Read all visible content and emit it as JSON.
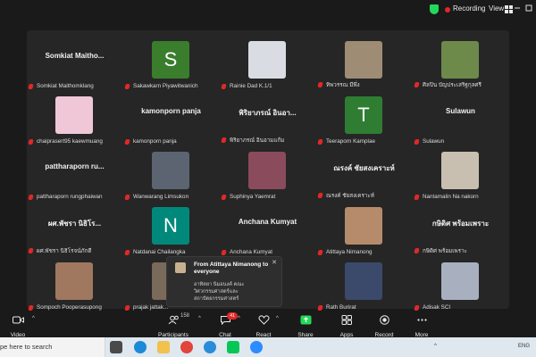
{
  "topbar": {
    "recording_label": "Recording",
    "view_label": "View"
  },
  "participants": [
    {
      "display": "Somkiat  Maitho...",
      "label": "Somkiat Maithomklang",
      "kind": "name"
    },
    {
      "display": "S",
      "label": "Sakawkarn Piyawitwanich",
      "kind": "avatar",
      "color": "#3a7d2c"
    },
    {
      "display": "",
      "label": "Rainie Dad K.1/1",
      "kind": "photo",
      "color": "#d9dde3"
    },
    {
      "display": "",
      "label": "ทิพวรรณ มีพึ่ง",
      "kind": "photo",
      "color": "#9e8c74"
    },
    {
      "display": "",
      "label": "ศิลปิน บัญประเสริฐกุลศรี",
      "kind": "photo",
      "color": "#6d8a4a"
    },
    {
      "display": "",
      "label": "chaiprasert95 kaewmuang",
      "kind": "photo",
      "color": "#f0c7d7"
    },
    {
      "display": "kamonporn panja",
      "label": "kamonporn panja",
      "kind": "name"
    },
    {
      "display": "พิริยาภรณ์  อินอา...",
      "label": "พิริยาภรณ์  อินอามแก้ม",
      "kind": "name"
    },
    {
      "display": "T",
      "label": "Teeraporn Kamplae",
      "kind": "avatar",
      "color": "#2e7d32"
    },
    {
      "display": "Sulawun",
      "label": "Sulawun",
      "kind": "name"
    },
    {
      "display": "pattharaporn  ru...",
      "label": "pattharaporn rungphaiwan",
      "kind": "name"
    },
    {
      "display": "",
      "label": "Wanwarang Limsukon",
      "kind": "photo",
      "color": "#5b6470"
    },
    {
      "display": "",
      "label": "Suphinya Yaemrat",
      "kind": "photo",
      "color": "#8a4b5d"
    },
    {
      "display": "ณรงค์ ชัยสงเคราะห์",
      "label": "ณรงค์ ชัยสงเคราะห์",
      "kind": "name"
    },
    {
      "display": "",
      "label": "Nantamalin Na nakorn",
      "kind": "photo",
      "color": "#c8bfb0"
    },
    {
      "display": "ผศ.พัชรา  นิธิโร...",
      "label": "ผศ.พัชรา นิธิโรจน์ภักดี",
      "kind": "name"
    },
    {
      "display": "N",
      "label": "Natdanai Chailangka",
      "kind": "avatar",
      "color": "#00897b"
    },
    {
      "display": "Anchana Kumyat",
      "label": "Anchana Kumyat",
      "kind": "name"
    },
    {
      "display": "",
      "label": "Atittaya Nimanong",
      "kind": "photo",
      "color": "#b68b6b"
    },
    {
      "display": "กษิดิศ  พร้อมเพราะ",
      "label": "กษิดิศ พร้อมเพราะ",
      "kind": "name"
    },
    {
      "display": "",
      "label": "Sompoch Pooperasupong",
      "kind": "photo",
      "color": "#a07860"
    },
    {
      "display": "",
      "label": "prajak jattak...",
      "kind": "photo",
      "color": "#7a6a5a"
    },
    {
      "display": "",
      "label": "",
      "kind": "blank"
    },
    {
      "display": "",
      "label": "Rath Burirat",
      "kind": "photo",
      "color": "#3b4a6b"
    },
    {
      "display": "",
      "label": "Adisak SCI",
      "kind": "photo",
      "color": "#a8b0c0"
    }
  ],
  "chat_popup": {
    "title": "From Atittaya Nimanong to everyone",
    "message": "อาทิตยา นิมอนงค์  คณะวิศวกรรมศาสตร์และสถาปัตยกรรมศาสตร์"
  },
  "toolbar": {
    "video": "Video",
    "participants": "Participants",
    "participants_count": "158",
    "chat": "Chat",
    "chat_badge": "41",
    "react": "React",
    "share": "Share",
    "apps": "Apps",
    "record": "Record",
    "more": "More"
  },
  "taskbar": {
    "search_text": "pe here to search",
    "lang": "ENG"
  },
  "colors": {
    "share_green": "#23d959",
    "recording_red": "#e02828"
  }
}
